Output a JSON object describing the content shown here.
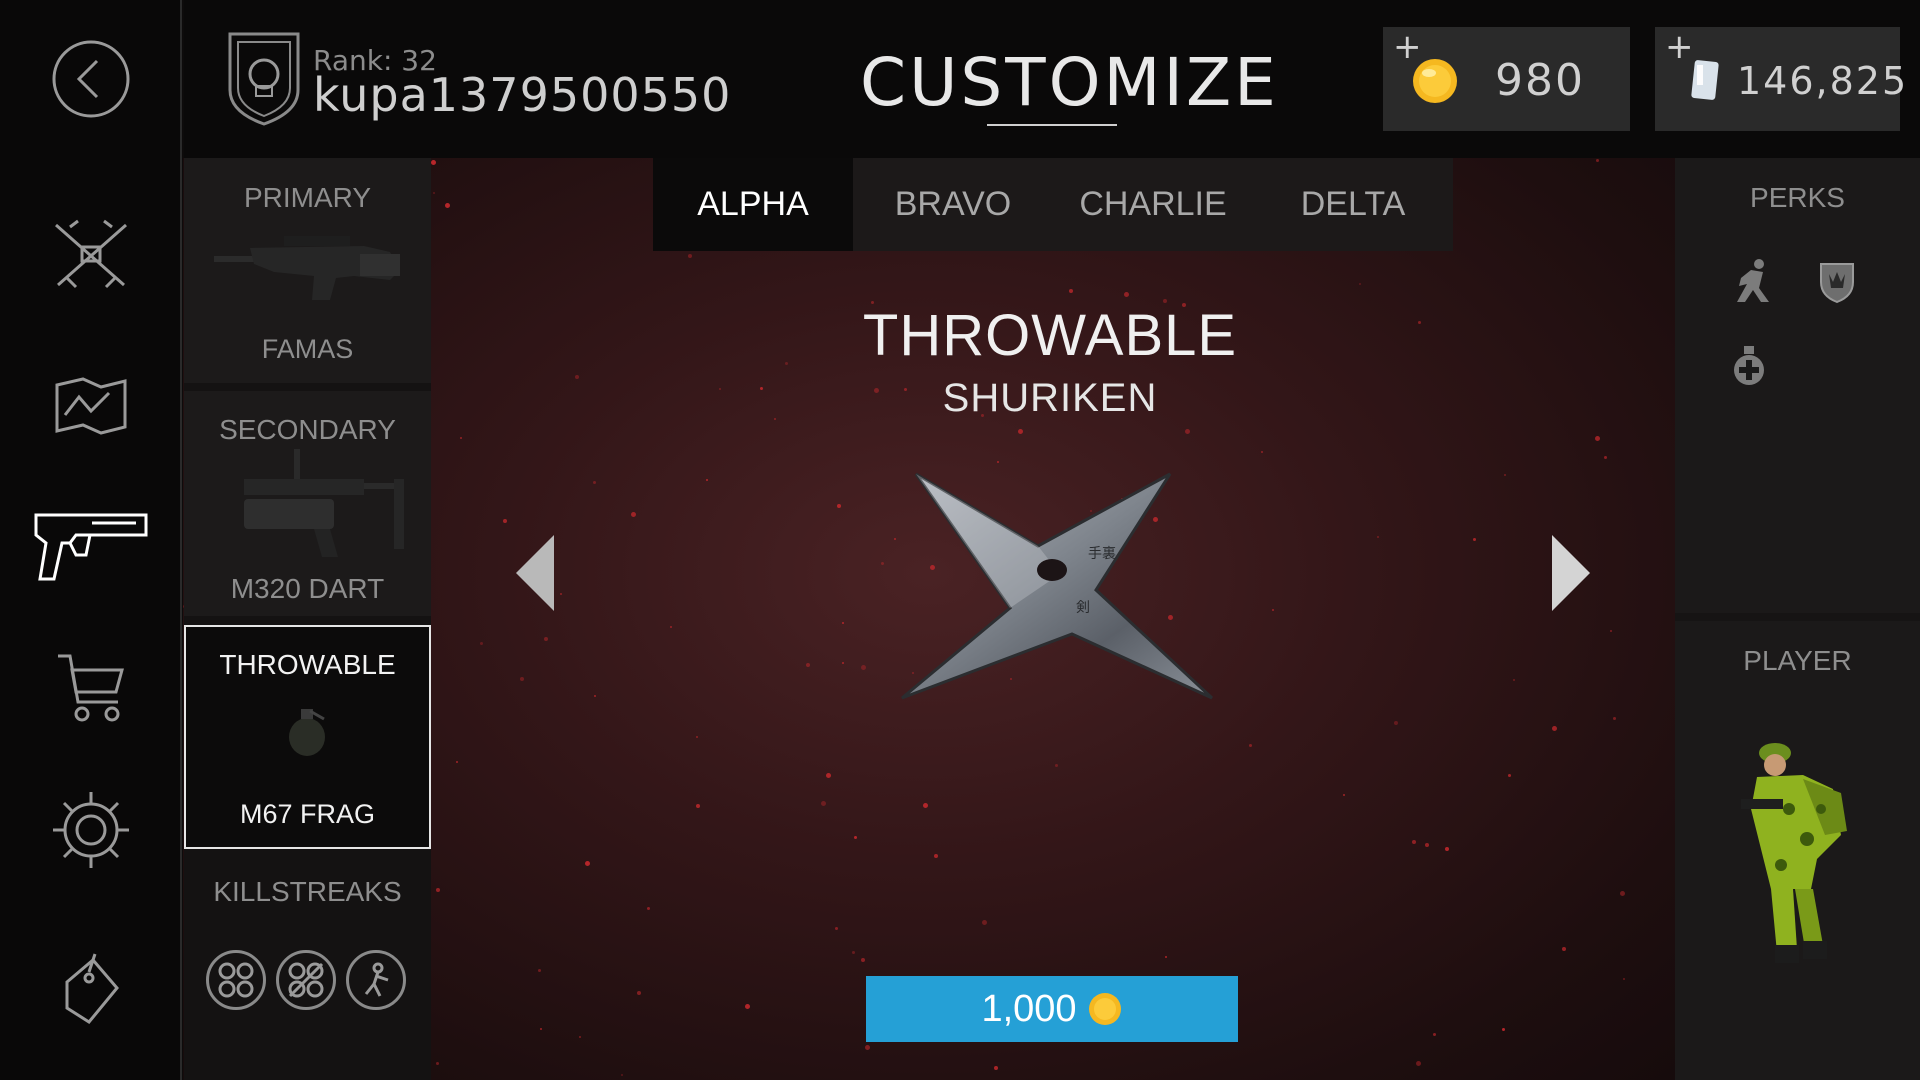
{
  "header": {
    "rank_label": "Rank: 32",
    "username": "kupa1379500550",
    "title": "CUSTOMIZE",
    "coins": {
      "plus": "+",
      "amount": "980"
    },
    "cards": {
      "plus": "+",
      "amount": "146,825"
    }
  },
  "nav": {
    "items": [
      {
        "icon": "back-arrow-icon"
      },
      {
        "icon": "crossed-rifles-icon"
      },
      {
        "icon": "map-icon"
      },
      {
        "icon": "pistol-icon",
        "active": true
      },
      {
        "icon": "shopping-cart-icon"
      },
      {
        "icon": "gear-icon"
      },
      {
        "icon": "dog-tag-icon"
      }
    ]
  },
  "loadout": {
    "primary": {
      "title": "PRIMARY",
      "name": "FAMAS"
    },
    "secondary": {
      "title": "SECONDARY",
      "name": "M320 DART"
    },
    "throwable": {
      "title": "THROWABLE",
      "name": "M67 FRAG"
    },
    "killstreaks": {
      "title": "KILLSTREAKS",
      "icons": [
        "uav-drone-icon",
        "counter-uav-icon",
        "soldier-icon"
      ]
    }
  },
  "tabs": [
    {
      "label": "ALPHA",
      "active": true
    },
    {
      "label": "BRAVO"
    },
    {
      "label": "CHARLIE"
    },
    {
      "label": "DELTA"
    }
  ],
  "item": {
    "category": "THROWABLE",
    "name": "SHURIKEN",
    "price": "1,000"
  },
  "right": {
    "perks_title": "PERKS",
    "perk_icons": [
      "runner-icon",
      "shield-icon",
      "medkit-icon"
    ],
    "player_title": "PLAYER"
  },
  "colors": {
    "buy_button": "#25a0d6",
    "coin": "#f5b820",
    "accent_red": "#c0282c"
  }
}
